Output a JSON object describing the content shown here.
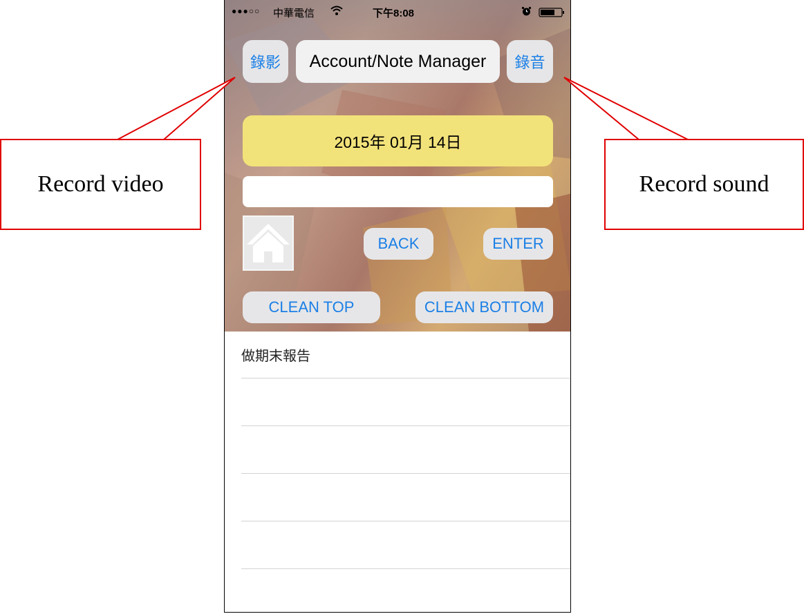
{
  "status_bar": {
    "signal": "●●●○○",
    "carrier": "中華電信",
    "time": "下午8:08"
  },
  "header": {
    "record_video_label": "錄影",
    "title": "Account/Note Manager",
    "record_sound_label": "錄音"
  },
  "date": "2015年 01月 14日",
  "note_input": {
    "value": "",
    "placeholder": ""
  },
  "buttons": {
    "back": "BACK",
    "enter": "ENTER",
    "clean_top": "CLEAN TOP",
    "clean_bottom": "CLEAN BOTTOM"
  },
  "notes": [
    "做期末報告",
    "",
    "",
    "",
    "",
    ""
  ],
  "annotations": {
    "record_video": "Record video",
    "record_sound": "Record sound"
  },
  "colors": {
    "accent": "#1a7fe6",
    "date_background": "#f2e27a",
    "callout_border": "#e00000"
  }
}
